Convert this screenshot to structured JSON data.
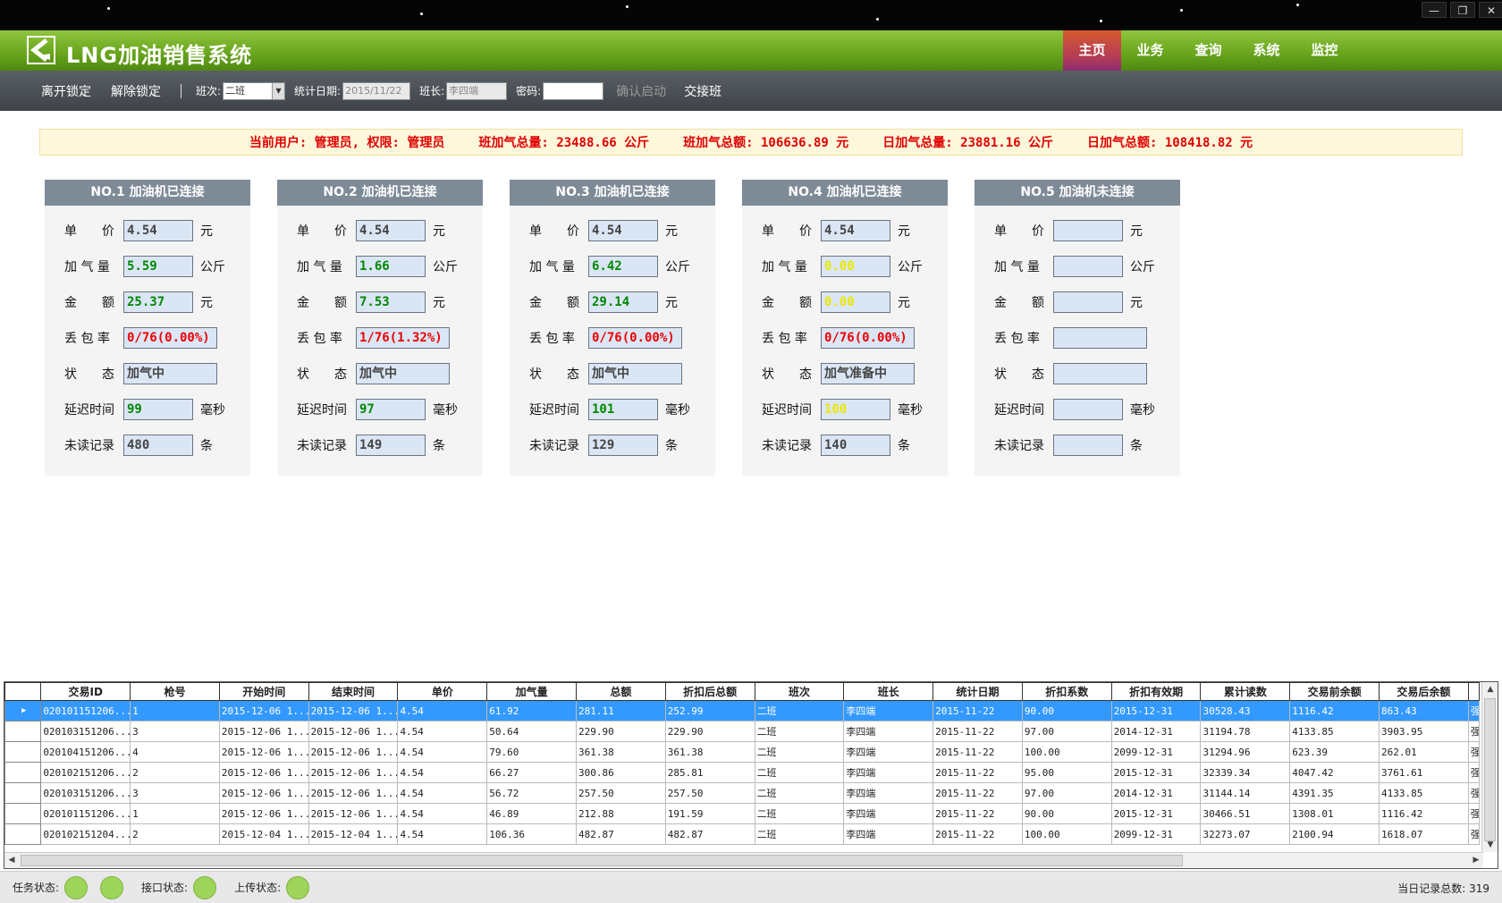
{
  "window": {
    "min_icon": "minimize-icon",
    "max_icon": "maximize-icon",
    "close_icon": "close-icon",
    "min_glyph": "—",
    "max_glyph": "❐",
    "close_glyph": "✕"
  },
  "header": {
    "title": "LNG加油销售系统",
    "nav": [
      "主页",
      "业务",
      "查询",
      "系统",
      "监控"
    ],
    "active_index": 0
  },
  "toolbar": {
    "leave_lock": "离开锁定",
    "unlock": "解除锁定",
    "shift_label": "班次:",
    "shift_value": "二班",
    "date_label": "统计日期:",
    "date_value": "2015/11/22",
    "leader_label": "班长:",
    "leader_value": "李四端",
    "password_label": "密码:",
    "password_value": "",
    "confirm_start": "确认启动",
    "handover": "交接班"
  },
  "banner": {
    "user": "当前用户: 管理员, 权限: 管理员",
    "shift_volume": "班加气总量: 23488.66 公斤",
    "shift_amount": "班加气总额: 106636.89 元",
    "day_volume": "日加气总量: 23881.16 公斤",
    "day_amount": "日加气总额: 108418.82 元"
  },
  "labels": {
    "price": "单　　价",
    "volume": "加 气 量",
    "amount": "金　　额",
    "loss": "丢 包 率",
    "status": "状　　态",
    "delay": "延迟时间",
    "unread": "未读记录",
    "unit_yuan": "元",
    "unit_kg": "公斤",
    "unit_ms": "毫秒",
    "unit_count": "条"
  },
  "colors": {
    "green_text": "#008800",
    "red_text": "#ee0000",
    "yellow_text": "#e8e800",
    "gray_text": "#444444",
    "led_green": "#9fd45b",
    "header_green": "#6aa61e",
    "active_tab": "#b23a5a",
    "selected_row": "#3399ff"
  },
  "dispensers": [
    {
      "title": "NO.1 加油机已连接",
      "price": "4.54",
      "volume": "5.59",
      "amount": "25.37",
      "loss": "0/76(0.00%)",
      "status": "加气中",
      "delay": "99",
      "unread": "480",
      "value_color": "green"
    },
    {
      "title": "NO.2 加油机已连接",
      "price": "4.54",
      "volume": "1.66",
      "amount": "7.53",
      "loss": "1/76(1.32%)",
      "status": "加气中",
      "delay": "97",
      "unread": "149",
      "value_color": "green"
    },
    {
      "title": "NO.3 加油机已连接",
      "price": "4.54",
      "volume": "6.42",
      "amount": "29.14",
      "loss": "0/76(0.00%)",
      "status": "加气中",
      "delay": "101",
      "unread": "129",
      "value_color": "green"
    },
    {
      "title": "NO.4 加油机已连接",
      "price": "4.54",
      "volume": "0.00",
      "amount": "0.00",
      "loss": "0/76(0.00%)",
      "status": "加气准备中",
      "delay": "100",
      "unread": "140",
      "value_color": "yellow"
    },
    {
      "title": "NO.5 加油机未连接",
      "price": "",
      "volume": "",
      "amount": "",
      "loss": "",
      "status": "",
      "delay": "",
      "unread": "",
      "value_color": "green"
    }
  ],
  "grid": {
    "columns": [
      "交易ID",
      "枪号",
      "开始时间",
      "结束时间",
      "单价",
      "加气量",
      "总额",
      "折扣后总额",
      "班次",
      "班长",
      "统计日期",
      "折扣系数",
      "折扣有效期",
      "累计读数",
      "交易前余额",
      "交易后余额"
    ],
    "rows": [
      [
        "020101151206...",
        "1",
        "2015-12-06 1...",
        "2015-12-06 1...",
        "4.54",
        "61.92",
        "281.11",
        "252.99",
        "二班",
        "李四端",
        "2015-11-22",
        "90.00",
        "2015-12-31",
        "30528.43",
        "1116.42",
        "863.43"
      ],
      [
        "020103151206...",
        "3",
        "2015-12-06 1...",
        "2015-12-06 1...",
        "4.54",
        "50.64",
        "229.90",
        "229.90",
        "二班",
        "李四端",
        "2015-11-22",
        "97.00",
        "2014-12-31",
        "31194.78",
        "4133.85",
        "3903.95"
      ],
      [
        "020104151206...",
        "4",
        "2015-12-06 1...",
        "2015-12-06 1...",
        "4.54",
        "79.60",
        "361.38",
        "361.38",
        "二班",
        "李四端",
        "2015-11-22",
        "100.00",
        "2099-12-31",
        "31294.96",
        "623.39",
        "262.01"
      ],
      [
        "020102151206...",
        "2",
        "2015-12-06 1...",
        "2015-12-06 1...",
        "4.54",
        "66.27",
        "300.86",
        "285.81",
        "二班",
        "李四端",
        "2015-11-22",
        "95.00",
        "2015-12-31",
        "32339.34",
        "4047.42",
        "3761.61"
      ],
      [
        "020103151206...",
        "3",
        "2015-12-06 1...",
        "2015-12-06 1...",
        "4.54",
        "56.72",
        "257.50",
        "257.50",
        "二班",
        "李四端",
        "2015-11-22",
        "97.00",
        "2014-12-31",
        "31144.14",
        "4391.35",
        "4133.85"
      ],
      [
        "020101151206...",
        "1",
        "2015-12-06 1...",
        "2015-12-06 1...",
        "4.54",
        "46.89",
        "212.88",
        "191.59",
        "二班",
        "李四端",
        "2015-11-22",
        "90.00",
        "2015-12-31",
        "30466.51",
        "1308.01",
        "1116.42"
      ],
      [
        "020102151204...",
        "2",
        "2015-12-04 1...",
        "2015-12-04 1...",
        "4.54",
        "106.36",
        "482.87",
        "482.87",
        "二班",
        "李四端",
        "2015-11-22",
        "100.00",
        "2099-12-31",
        "32273.07",
        "2100.94",
        "1618.07"
      ]
    ],
    "selected_row": 0,
    "row_indicator": "▶",
    "overflow_glyph": "强"
  },
  "statusbar": {
    "task_label": "任务状态:",
    "interface_label": "接口状态:",
    "upload_label": "上传状态:",
    "total_label": "当日记录总数: 319"
  }
}
